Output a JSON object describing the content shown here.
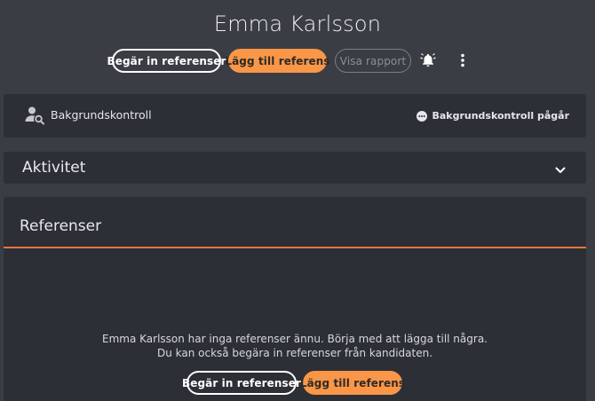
{
  "header": {
    "name": "Emma Karlsson",
    "request_refs_label": "Begär in referenser",
    "add_ref_label": "Lägg till referens",
    "view_report_label": "Visa rapport",
    "bell_icon": "bell-icon",
    "more_icon": "more-vertical-icon"
  },
  "background_check": {
    "title": "Bakgrundskontroll",
    "status": "Bakgrundskontroll pågår",
    "icon": "person-search-icon",
    "status_icon": "dots-circle-icon"
  },
  "activity": {
    "title": "Aktivitet",
    "icon": "chevron-down-icon"
  },
  "references": {
    "title": "Referenser",
    "empty_line1": "Emma Karlsson har inga referenser ännu. Börja med att lägga till några.",
    "empty_line2": "Du kan också begära in referenser från kandidaten.",
    "request_refs_label": "Begär in referenser",
    "add_ref_label": "Lägg till referens"
  },
  "colors": {
    "background": "#3a3d44",
    "card": "#2c2f35",
    "accent": "#fa9648",
    "accent_line": "#e8743d"
  }
}
